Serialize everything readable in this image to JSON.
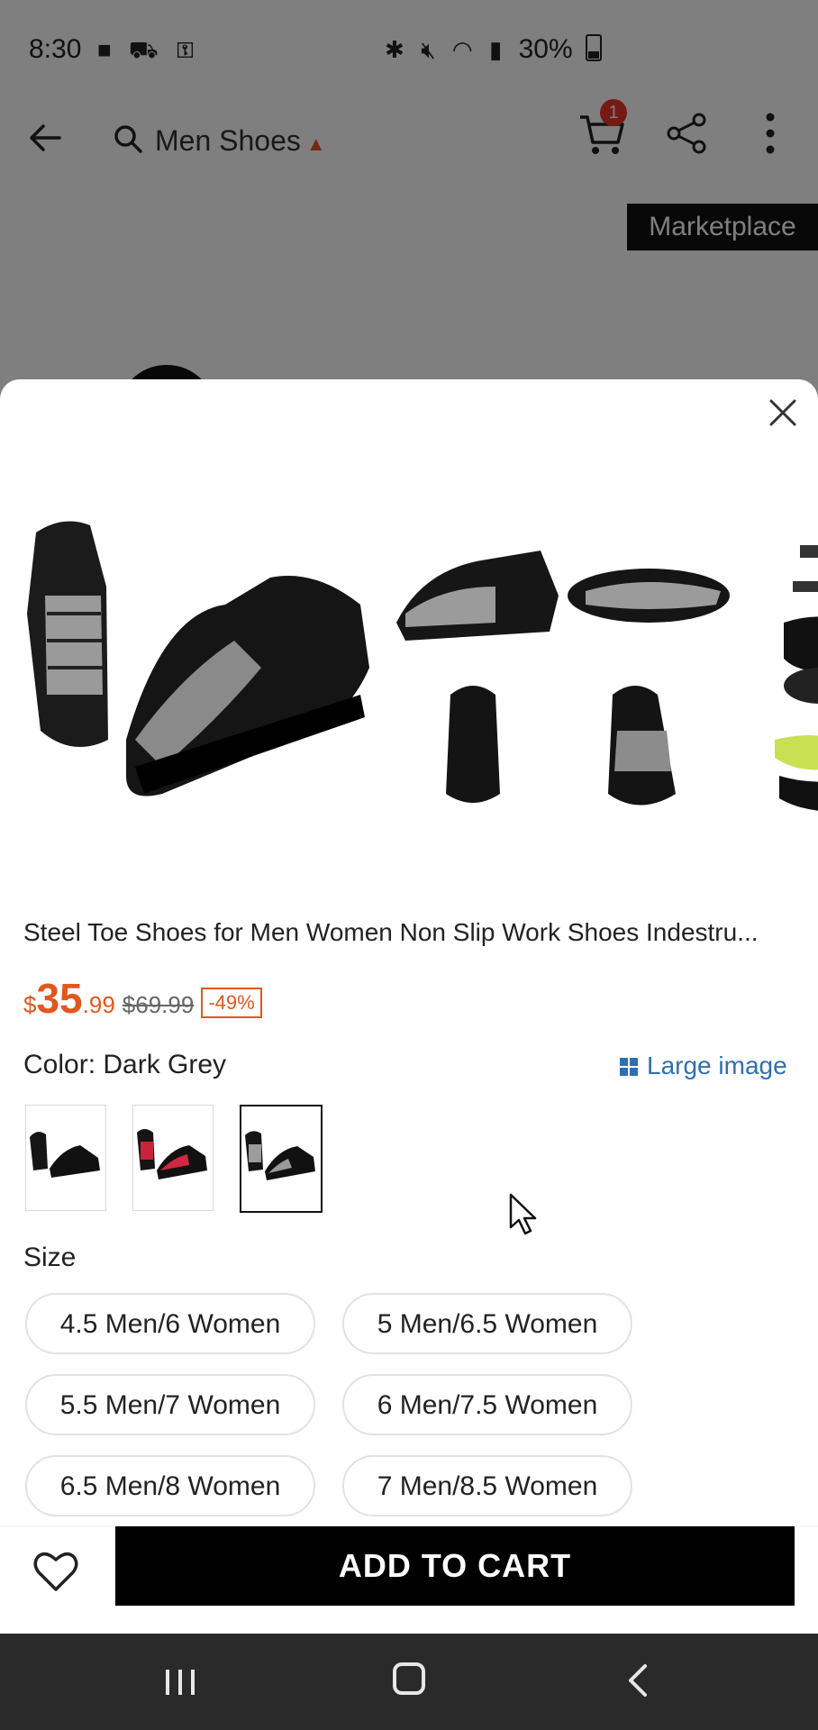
{
  "status_bar": {
    "time": "8:30",
    "battery": "30%"
  },
  "header": {
    "search_text": "Men Shoes",
    "cart_badge": "1"
  },
  "background": {
    "marketplace_tag": "Marketplace"
  },
  "product": {
    "title": "Steel Toe Shoes for Men Women Non Slip Work Shoes Indestru...",
    "price_currency": "$",
    "price_whole": "35",
    "price_cents": ".99",
    "price_original": "$69.99",
    "discount": "-49%",
    "color_label": "Color: Dark Grey",
    "large_image_label": "Large image",
    "size_label": "Size",
    "sizes": [
      "4.5 Men/6 Women",
      "5 Men/6.5 Women",
      "5.5 Men/7 Women",
      "6 Men/7.5 Women",
      "6.5 Men/8 Women",
      "7 Men/8.5 Women"
    ],
    "selected_swatch": "Dark Grey"
  },
  "actions": {
    "add_to_cart": "ADD TO CART"
  },
  "colors": {
    "price": "#e2571c",
    "link": "#2f6fb0",
    "badge": "#e8362a"
  }
}
